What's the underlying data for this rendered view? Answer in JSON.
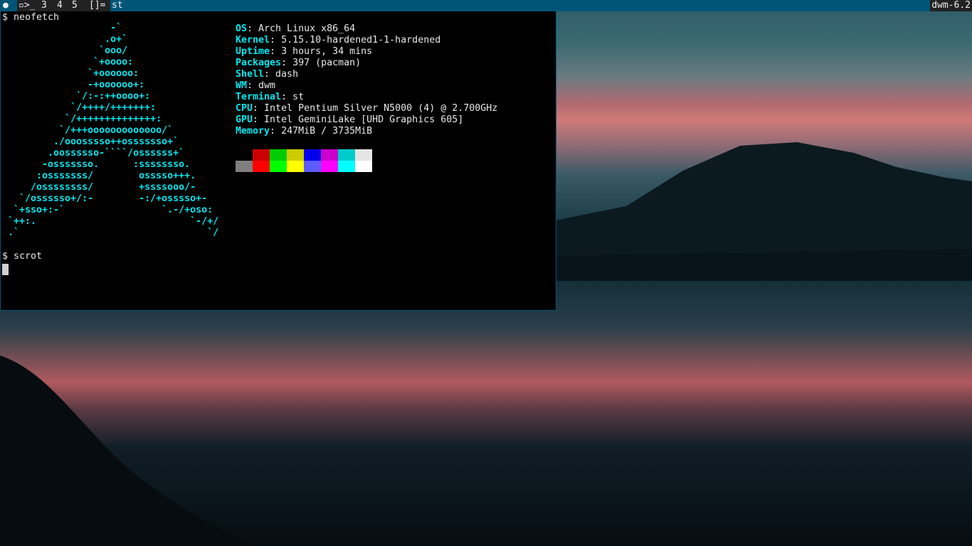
{
  "bar": {
    "layout_icon": "arch-logo-icon",
    "tags": [
      "▫>_",
      "3",
      "4",
      "5"
    ],
    "layout_symbol": "[]=",
    "window_title": "st",
    "status": "dwm-6.2"
  },
  "terminal": {
    "prompt1": "$ neofetch",
    "ascii_art": "                   -`\n                  .o+`\n                 `ooo/\n                `+oooo:\n               `+oooooo:\n               -+oooooo+:\n             `/:-:++oooo+:\n            `/++++/+++++++:\n           `/++++++++++++++:\n          `/+++ooooooooooooo/`\n         ./ooosssso++osssssso+`\n        .oossssso-````/ossssss+`\n       -osssssso.      :ssssssso.\n      :osssssss/        osssso+++.\n     /ossssssss/        +ssssooo/-\n   `/ossssso+/:-        -:/+osssso+-\n  `+sso+:-`                 `.-/+oso:\n `++:.                           `-/+/\n .`                                 `/",
    "info": [
      {
        "key": "OS",
        "value": "Arch Linux x86_64"
      },
      {
        "key": "Kernel",
        "value": "5.15.10-hardened1-1-hardened"
      },
      {
        "key": "Uptime",
        "value": "3 hours, 34 mins"
      },
      {
        "key": "Packages",
        "value": "397 (pacman)"
      },
      {
        "key": "Shell",
        "value": "dash"
      },
      {
        "key": "WM",
        "value": "dwm"
      },
      {
        "key": "Terminal",
        "value": "st"
      },
      {
        "key": "CPU",
        "value": "Intel Pentium Silver N5000 (4) @ 2.700GHz"
      },
      {
        "key": "GPU",
        "value": "Intel GeminiLake [UHD Graphics 605]"
      },
      {
        "key": "Memory",
        "value": "247MiB / 3735MiB"
      }
    ],
    "palette_normal": [
      "#000000",
      "#cc0000",
      "#00cc00",
      "#cccc00",
      "#0000ee",
      "#cc00cc",
      "#00cccc",
      "#e5e5e5"
    ],
    "palette_bright": [
      "#7f7f7f",
      "#ff0000",
      "#00ff00",
      "#ffff00",
      "#5c5cff",
      "#ff00ff",
      "#00ffff",
      "#ffffff"
    ],
    "prompt2": "$ scrot"
  }
}
